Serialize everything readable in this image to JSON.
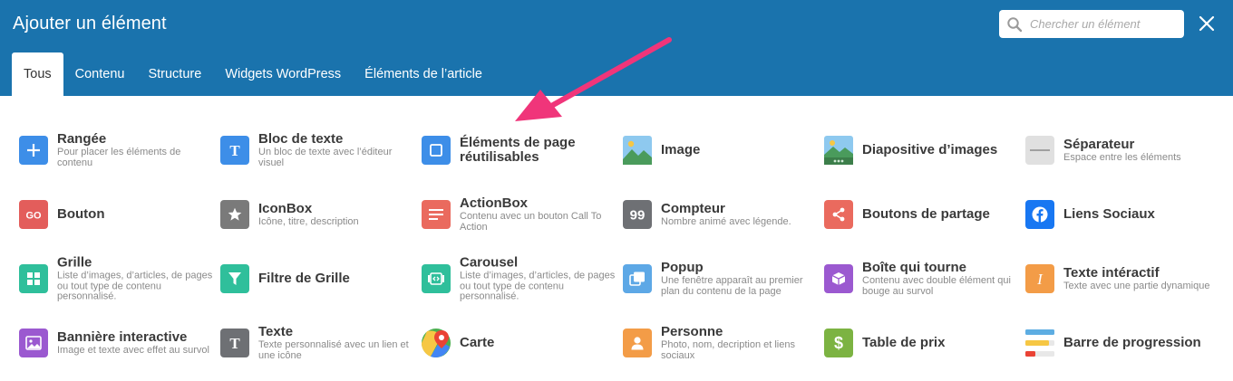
{
  "header": {
    "title": "Ajouter un élément",
    "search_placeholder": "Chercher un élément",
    "search_value": ""
  },
  "tabs": [
    {
      "label": "Tous",
      "active": true
    },
    {
      "label": "Contenu"
    },
    {
      "label": "Structure"
    },
    {
      "label": "Widgets WordPress"
    },
    {
      "label": "Éléments de l’article"
    }
  ],
  "elements": [
    {
      "name": "Rangée",
      "desc": "Pour placer les éléments de contenu",
      "icon": "plus-icon",
      "color": "#3d8ee8"
    },
    {
      "name": "Bloc de texte",
      "desc": "Un bloc de texte avec l’éditeur visuel",
      "icon": "text-block-icon",
      "color": "#3d8ee8"
    },
    {
      "name": "Éléments de page réutilisables",
      "desc": "",
      "icon": "square-icon",
      "color": "#3d8ee8"
    },
    {
      "name": "Image",
      "desc": "",
      "icon": "image-icon",
      "color": "#6ab04c"
    },
    {
      "name": "Diapositive d’images",
      "desc": "",
      "icon": "slideshow-icon",
      "color": "#6ab04c"
    },
    {
      "name": "Séparateur",
      "desc": "Espace entre les éléments",
      "icon": "separator-icon",
      "color": "#e0e0e0"
    },
    {
      "name": "Bouton",
      "desc": "",
      "icon": "button-go-icon",
      "color": "#e35d5b"
    },
    {
      "name": "IconBox",
      "desc": "Icône, titre, description",
      "icon": "star-icon",
      "color": "#7a7a7a"
    },
    {
      "name": "ActionBox",
      "desc": "Contenu avec un bouton Call To Action",
      "icon": "actionbox-icon",
      "color": "#ea6a5e"
    },
    {
      "name": "Compteur",
      "desc": "Nombre animé avec légende.",
      "icon": "counter-99-icon",
      "color": "#6e7074"
    },
    {
      "name": "Boutons de partage",
      "desc": "",
      "icon": "share-icon",
      "color": "#ea6a5e"
    },
    {
      "name": "Liens Sociaux",
      "desc": "",
      "icon": "facebook-icon",
      "color": "#1877f2"
    },
    {
      "name": "Grille",
      "desc": "Liste d’images, d’articles, de pages ou tout type de contenu personnalisé.",
      "icon": "grid-icon",
      "color": "#2fbf9b"
    },
    {
      "name": "Filtre de Grille",
      "desc": "",
      "icon": "filter-icon",
      "color": "#2fbf9b"
    },
    {
      "name": "Carousel",
      "desc": "Liste d’images, d’articles, de pages ou tout type de contenu personnalisé.",
      "icon": "carousel-icon",
      "color": "#2fbf9b"
    },
    {
      "name": "Popup",
      "desc": "Une fenêtre apparaît au premier plan du contenu de la page",
      "icon": "popup-icon",
      "color": "#5da8e6"
    },
    {
      "name": "Boîte qui tourne",
      "desc": "Contenu avec double élément qui bouge au survol",
      "icon": "flipbox-icon",
      "color": "#9b59d0"
    },
    {
      "name": "Texte intéractif",
      "desc": "Texte avec une partie dynamique",
      "icon": "italic-i-icon",
      "color": "#f39c47"
    },
    {
      "name": "Bannière interactive",
      "desc": "Image et texte avec effet au survol",
      "icon": "banner-icon",
      "color": "#9b59d0"
    },
    {
      "name": "Texte",
      "desc": "Texte personnalisé avec un lien et une icône",
      "icon": "text-t-icon",
      "color": "#6e7074"
    },
    {
      "name": "Carte",
      "desc": "",
      "icon": "map-icon",
      "color": "#4caf50"
    },
    {
      "name": "Personne",
      "desc": "Photo, nom, decription et liens sociaux",
      "icon": "person-icon",
      "color": "#f39c47"
    },
    {
      "name": "Table de prix",
      "desc": "",
      "icon": "dollar-icon",
      "color": "#7cb342"
    },
    {
      "name": "Barre de progression",
      "desc": "",
      "icon": "progress-bars-icon",
      "color": "#5dade2"
    }
  ],
  "colors": {
    "header_bg": "#1a73ad",
    "annotation_arrow": "#f0357a"
  }
}
